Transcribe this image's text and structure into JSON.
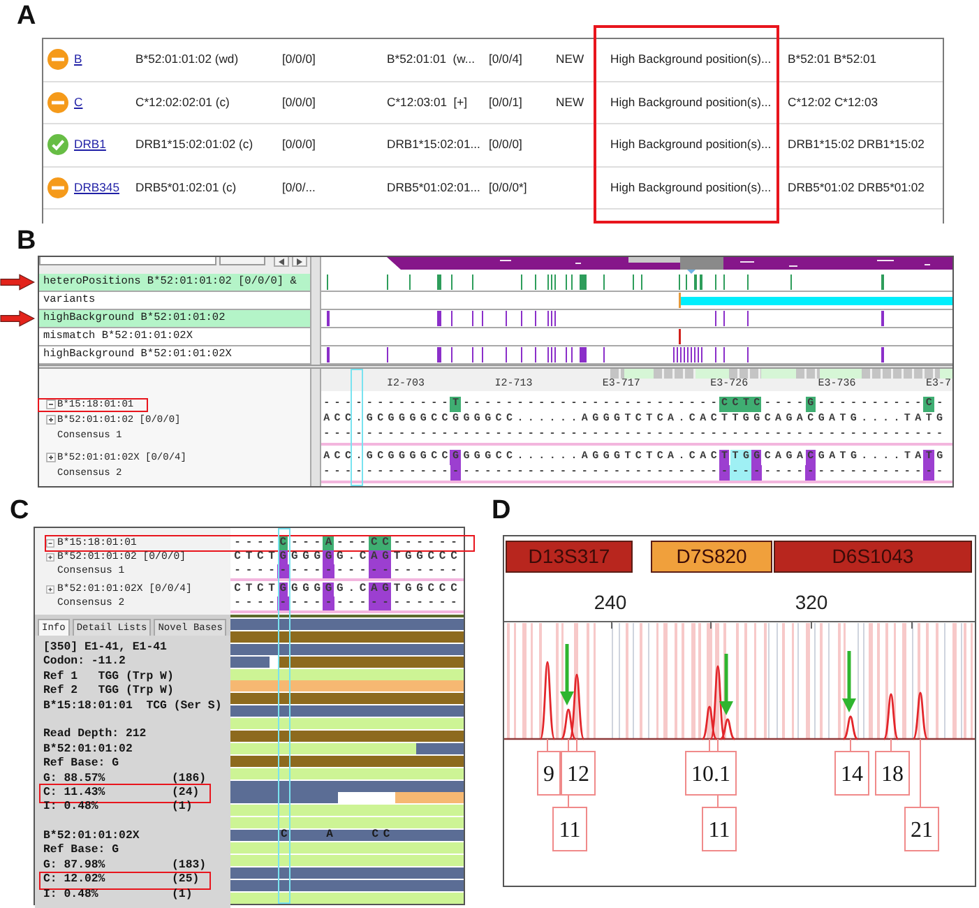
{
  "panel_a": {
    "label": "A",
    "table": {
      "columns": [
        {
          "boxed": false
        },
        {
          "boxed": false
        },
        {
          "boxed": false
        },
        {
          "boxed": false
        },
        {
          "boxed": false
        },
        {
          "boxed": false
        },
        {
          "boxed": true
        },
        {
          "boxed": false
        }
      ],
      "rows": [
        {
          "kind": "warning",
          "column_1": "B",
          "column_2": "B*52:01:01:02 (wd)",
          "column_3": "[0/0/0]",
          "column_4": "B*52:01:01  (w...",
          "column_5": "[0/0/4]",
          "column_6": "NEW",
          "column_7": "High Background position(s)...",
          "column_8": "B*52:01 B*52:01"
        },
        {
          "kind": "warning",
          "column_1": "C",
          "column_2": "C*12:02:02:01 (c)",
          "column_3": "[0/0/0]",
          "column_4": "C*12:03:01  [+]",
          "column_5": "[0/0/1]",
          "column_6": "NEW",
          "column_7": "High Background position(s)...",
          "column_8": "C*12:02 C*12:03"
        },
        {
          "kind": "ok",
          "column_1": "DRB1",
          "column_2": "DRB1*15:02:01:02 (c)",
          "column_3": "[0/0/0]",
          "column_4": "DRB1*15:02:01...",
          "column_5": "[0/0/0]",
          "column_7": "High Background position(s)...",
          "column_8": "DRB1*15:02 DRB1*15:02"
        },
        {
          "kind": "warning",
          "column_1": "DRB345",
          "column_2": "DRB5*01:02:01 (c)",
          "column_3": "[0/0/...",
          "column_4": "DRB5*01:02:01...",
          "column_5": "[0/0/0*]",
          "column_7": "High Background position(s)...",
          "column_8": "DRB5*01:02 DRB5*01:02"
        }
      ]
    }
  },
  "panel_b": {
    "label": "B",
    "tracks": [
      {
        "name": "heteroPositions B*52:01:01:02 [0/0/0] &",
        "kind": "hetero",
        "selected": true,
        "arrow": true
      },
      {
        "name": "variants",
        "kind": "variants",
        "selected": false,
        "arrow": false
      },
      {
        "name": "highBackground B*52:01:01:02",
        "kind": "background",
        "selected": true,
        "arrow": true
      },
      {
        "name": "mismatch B*52:01:01:02X",
        "kind": "mismatch",
        "selected": false,
        "arrow": false
      },
      {
        "name": "highBackground B*52:01:01:02X",
        "kind": "background",
        "selected": false,
        "arrow": false
      }
    ],
    "ruler": [
      "I2-703",
      "I2-713",
      "E3-717",
      "E3-726",
      "E3-736",
      "E3-7"
    ],
    "alleles": [
      {
        "name": "B*15:18:01:01",
        "expanded": true,
        "boxed": true,
        "sequence": [
          {
            "text": "------------"
          },
          {
            "text": "T",
            "color": "#3fae72"
          },
          {
            "text": "------------------------"
          },
          {
            "text": "CCTC",
            "color": "#3fae72"
          },
          {
            "text": "----"
          },
          {
            "text": "G",
            "color": "#3fae72"
          },
          {
            "text": "----------"
          },
          {
            "text": "C",
            "color": "#3fae72"
          },
          {
            "text": "-"
          }
        ]
      },
      {
        "name": "B*52:01:01:02 [0/0/0]",
        "expanded": false,
        "boxed": false,
        "sequence": [
          {
            "text": "ACC.GCGGGGCCGGGGCC......AGGGTCTCA.CACTTGGCAGACGATG....TATG"
          }
        ],
        "consensus": {
          "name": "Consensus 1",
          "text": "----------------------------------------------------------"
        }
      },
      {
        "name": "B*52:01:01:02X [0/0/4]",
        "expanded": false,
        "boxed": false,
        "sequence": [
          {
            "text": "ACC.GCGGGGCC"
          },
          {
            "text": "G",
            "color": "#9c3fd0"
          },
          {
            "text": "GGGCC......AGGGTCTCA.CAC"
          },
          {
            "text": "T",
            "color": "#9c3fd0"
          },
          {
            "text": "TG",
            "color": "#9ff0f4"
          },
          {
            "text": "G",
            "color": "#9c3fd0"
          },
          {
            "text": "CAGA"
          },
          {
            "text": "C",
            "color": "#9c3fd0"
          },
          {
            "text": "GATG....TA"
          },
          {
            "text": "T",
            "color": "#9c3fd0"
          },
          {
            "text": "G"
          }
        ],
        "consensus": {
          "name": "Consensus 2",
          "text": "----------------------------------------------------------"
        }
      }
    ],
    "column_cursor": true
  },
  "panel_c": {
    "label": "C",
    "alleles": [
      {
        "name": "B*15:18:01:01",
        "expanded": true,
        "boxed": true,
        "sequence": [
          {
            "text": "----"
          },
          {
            "text": "C",
            "color": "#3fae72"
          },
          {
            "text": "---"
          },
          {
            "text": "A",
            "color": "#3fae72"
          },
          {
            "text": "---"
          },
          {
            "text": "CC",
            "color": "#3fae72"
          },
          {
            "text": "------"
          }
        ]
      },
      {
        "name": "B*52:01:01:02 [0/0/0]",
        "expanded": false,
        "boxed": false,
        "sequence": [
          {
            "text": "CTCT"
          },
          {
            "text": "G",
            "color": "#9c3fd0"
          },
          {
            "text": "GGG"
          },
          {
            "text": "G",
            "color": "#9c3fd0"
          },
          {
            "text": "G.C"
          },
          {
            "text": "AG",
            "color": "#9c3fd0"
          },
          {
            "text": "TGGCCC"
          }
        ],
        "consensus": {
          "name": "Consensus 1",
          "text": "--------------------"
        }
      },
      {
        "name": "B*52:01:01:02X [0/0/4]",
        "expanded": false,
        "boxed": false,
        "sequence": [
          {
            "text": "CTCT"
          },
          {
            "text": "G",
            "color": "#9c3fd0"
          },
          {
            "text": "GGG"
          },
          {
            "text": "G",
            "color": "#9c3fd0"
          },
          {
            "text": "G.C"
          },
          {
            "text": "AG",
            "color": "#9c3fd0"
          },
          {
            "text": "TGGCCC"
          }
        ],
        "consensus": {
          "name": "Consensus 2",
          "text": "--------------------"
        }
      }
    ],
    "tabs": [
      {
        "label": "Info",
        "selected": true
      },
      {
        "label": "Detail Lists",
        "selected": false
      },
      {
        "label": "Novel Bases",
        "selected": false
      }
    ],
    "info_sections": [
      {
        "lines": [
          {
            "text": "[350] E1-41, E1-41",
            "boxed": false
          },
          {
            "text": "Codon: -11.2",
            "boxed": false
          },
          {
            "text": "Ref 1   TGG (Trp W)",
            "boxed": false
          },
          {
            "text": "Ref 2   TGG (Trp W)",
            "boxed": false
          },
          {
            "text": "B*15:18:01:01  TCG (Ser S)",
            "boxed": false
          }
        ]
      },
      {
        "lines": [
          {
            "text": "Read Depth: 212",
            "boxed": false
          },
          {
            "text": "B*52:01:01:02",
            "boxed": false
          },
          {
            "text": "Ref Base: G",
            "boxed": false
          },
          {
            "text": "G: 88.57%",
            "count": "(186)",
            "boxed": false
          },
          {
            "text": "C: 11.43%",
            "count": "(24)",
            "boxed": true
          },
          {
            "text": "I: 0.48%",
            "count": "(1)",
            "boxed": false
          }
        ]
      },
      {
        "lines": [
          {
            "text": "B*52:01:01:02X",
            "boxed": false
          },
          {
            "text": "Ref Base: G",
            "boxed": false
          },
          {
            "text": "G: 87.98%",
            "count": "(183)",
            "boxed": false
          },
          {
            "text": "C: 12.02%",
            "count": "(25)",
            "boxed": true
          },
          {
            "text": "I: 0.48%",
            "count": "(1)",
            "boxed": false
          }
        ]
      }
    ],
    "read_bases": "C   A   CC",
    "column_cursor": true
  },
  "panel_d": {
    "label": "D",
    "loci": [
      {
        "name": "D13S317",
        "color": "#b8261e",
        "peaks": [
          {
            "label": "9",
            "arrow": false
          },
          {
            "label": "11",
            "arrow": true
          },
          {
            "label": "12",
            "arrow": false
          }
        ]
      },
      {
        "name": "D7S820",
        "color": "#f0a03c",
        "peaks": [
          {
            "label": "10.1",
            "arrow": false
          },
          {
            "label": "11",
            "arrow": false
          },
          {
            "arrow": true
          }
        ]
      },
      {
        "name": "D6S1043",
        "color": "#b8261e",
        "peaks": [
          {
            "label": "14",
            "arrow": true
          },
          {
            "label": "18",
            "arrow": false
          },
          {
            "label": "21",
            "arrow": false
          }
        ]
      }
    ],
    "x_ticks": [
      "240",
      "320"
    ]
  }
}
